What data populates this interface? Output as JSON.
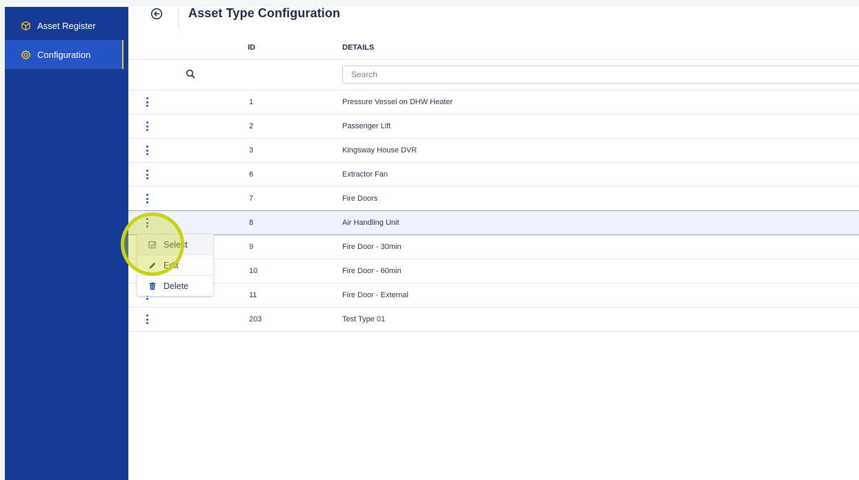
{
  "sidebar": {
    "items": [
      {
        "label": "Asset Register",
        "icon": "cube-icon"
      },
      {
        "label": "Configuration",
        "icon": "gear-icon",
        "active": true
      }
    ]
  },
  "header": {
    "title": "Asset Type Configuration",
    "back_icon": "back-arrow-circle-icon"
  },
  "table": {
    "columns": [
      "ID",
      "DETAILS"
    ],
    "search_placeholder": "Search",
    "rows": [
      {
        "id": "1",
        "details": "Pressure Vessel on DHW Heater"
      },
      {
        "id": "2",
        "details": "Passenger Lift"
      },
      {
        "id": "3",
        "details": "Kingsway House DVR"
      },
      {
        "id": "6",
        "details": "Extractor Fan"
      },
      {
        "id": "7",
        "details": "Fire Doors"
      },
      {
        "id": "8",
        "details": "Air Handling Unit",
        "selected": true
      },
      {
        "id": "9",
        "details": "Fire Door - 30min"
      },
      {
        "id": "10",
        "details": "Fire Door - 60min"
      },
      {
        "id": "11",
        "details": "Fire Door - External"
      },
      {
        "id": "203",
        "details": "Test Type 01"
      }
    ]
  },
  "context_menu": {
    "items": [
      {
        "label": "Select",
        "icon": "checkbox-icon"
      },
      {
        "label": "Edit",
        "icon": "pencil-icon"
      },
      {
        "label": "Delete",
        "icon": "trash-icon"
      }
    ]
  },
  "colors": {
    "sidebar_bg": "#163b96",
    "sidebar_active": "#2554c5",
    "active_indicator": "#f2c230",
    "accent_blue": "#2a4fb0",
    "highlight": "#c7d21a"
  }
}
